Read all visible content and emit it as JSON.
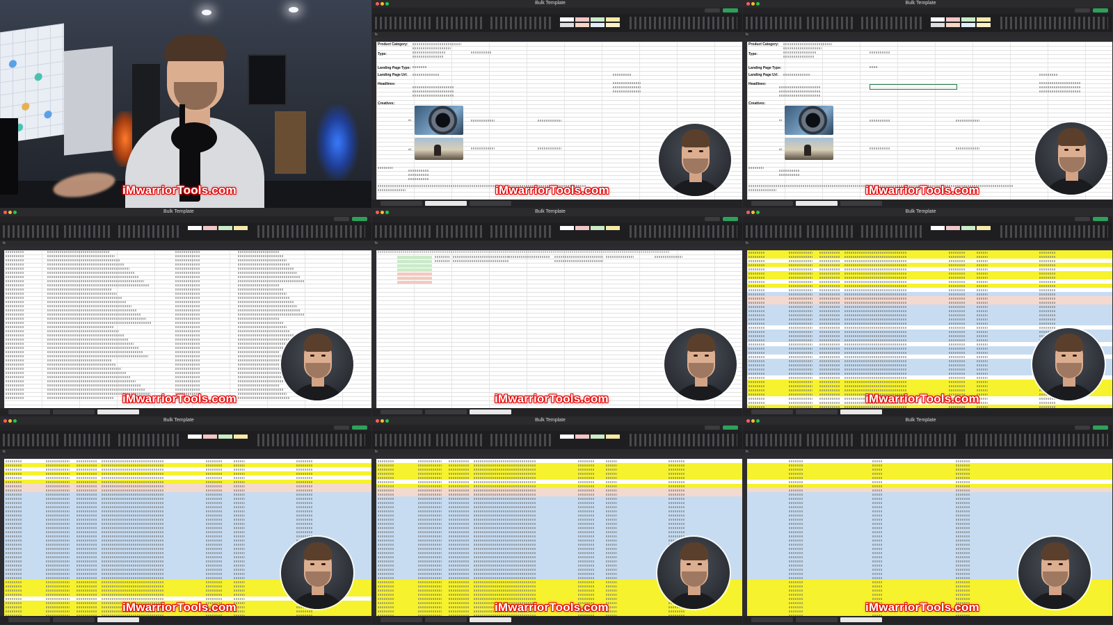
{
  "watermark": "iMwarriorTools.com",
  "excel": {
    "title": "Bulk Template"
  },
  "ad_setup": {
    "labels": {
      "product_category": "Product Category:",
      "type": "Type:",
      "landing_page_type": "Landing Page Type:",
      "landing_page_url": "Landing Page Url:",
      "headlines": "Headlines:",
      "creatives": "Creatives:"
    },
    "creative_numbers": [
      "#1",
      "#2"
    ]
  },
  "colors": {
    "highlight_yellow": "#f6f22d",
    "highlight_blue": "#c7dcf1",
    "highlight_pink": "#f4d9cf",
    "highlight_green": "#c9ecc7",
    "share_green": "#2fa05a",
    "watermark_red": "#e00000"
  },
  "icons": [
    "lens-photo",
    "hiker-photo",
    "facecam-avatar",
    "microphone"
  ]
}
